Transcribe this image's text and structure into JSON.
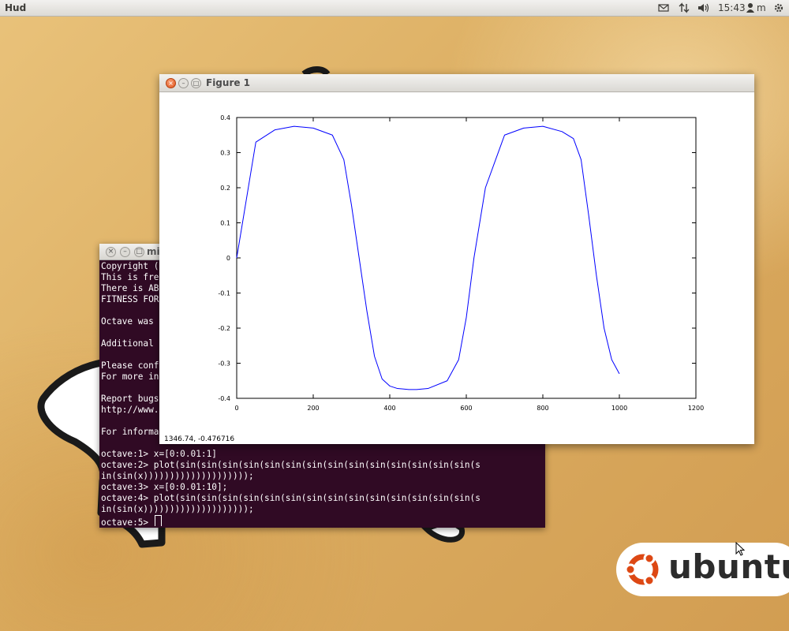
{
  "panel": {
    "app_title": "Hud",
    "clock": "15:43",
    "user": "m"
  },
  "terminal": {
    "title": "mi",
    "lines": [
      "Copyright (",
      "This is fre",
      "There is AB",
      "FITNESS FOR",
      "",
      "Octave was",
      "",
      "Additional",
      "",
      "Please conf",
      "For more in",
      "",
      "Report bugs",
      "http://www.",
      "",
      "For informa",
      "",
      "octave:1> x=[0:0.01:1]",
      "octave:2> plot(sin(sin(sin(sin(sin(sin(sin(sin(sin(sin(sin(sin(sin(sin(s",
      "in(sin(x))))))))))))))))))));",
      "octave:3> x=[0:0.01:10];",
      "octave:4> plot(sin(sin(sin(sin(sin(sin(sin(sin(sin(sin(sin(sin(sin(sin(s",
      "in(sin(x))))))))))))))))))));"
    ],
    "prompt": "octave:5> "
  },
  "figure": {
    "title": "Figure 1",
    "status_coords": "1346.74, -0.476716"
  },
  "chart_data": {
    "type": "line",
    "title": "",
    "xlabel": "",
    "ylabel": "",
    "xlim": [
      0,
      1200
    ],
    "ylim": [
      -0.4,
      0.4
    ],
    "xticks": [
      0,
      200,
      400,
      600,
      800,
      1000,
      1200
    ],
    "yticks": [
      0.4,
      0.3,
      0.2,
      0.1,
      0,
      -0.1,
      -0.2,
      -0.3,
      -0.4
    ],
    "grid": false,
    "series": [
      {
        "color": "#0000ff",
        "x": [
          0,
          50,
          100,
          150,
          200,
          250,
          280,
          300,
          320,
          340,
          360,
          380,
          400,
          420,
          450,
          470,
          500,
          550,
          580,
          600,
          620,
          650,
          700,
          750,
          800,
          850,
          880,
          900,
          920,
          940,
          960,
          980,
          1000
        ],
        "values": [
          0,
          0.33,
          0.365,
          0.375,
          0.37,
          0.35,
          0.28,
          0.15,
          0.0,
          -0.15,
          -0.28,
          -0.345,
          -0.365,
          -0.372,
          -0.375,
          -0.375,
          -0.372,
          -0.35,
          -0.29,
          -0.17,
          0.0,
          0.2,
          0.35,
          0.37,
          0.375,
          0.36,
          0.34,
          0.28,
          0.12,
          -0.05,
          -0.2,
          -0.29,
          -0.33
        ]
      }
    ]
  },
  "logo": {
    "text": "ubuntu"
  },
  "colors": {
    "terminal_bg": "#300a24",
    "plot_line": "#0000ff",
    "close_button": "#e2541c",
    "logo_orange": "#dd4814"
  }
}
